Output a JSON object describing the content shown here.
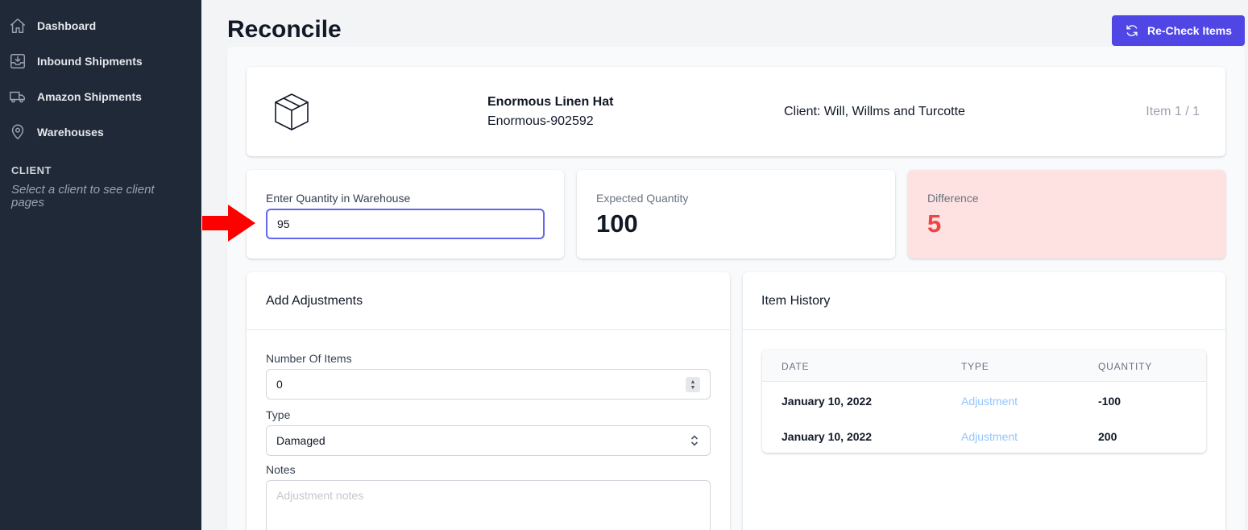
{
  "sidebar": {
    "items": [
      {
        "label": "Dashboard",
        "icon": "home-icon"
      },
      {
        "label": "Inbound Shipments",
        "icon": "inbox-download-icon"
      },
      {
        "label": "Amazon Shipments",
        "icon": "truck-icon"
      },
      {
        "label": "Warehouses",
        "icon": "map-pin-icon"
      }
    ],
    "client_heading": "CLIENT",
    "client_note": "Select a client to see client pages"
  },
  "header": {
    "title": "Reconcile",
    "recheck_label": "Re-Check Items"
  },
  "item": {
    "name": "Enormous Linen Hat",
    "sku": "Enormous-902592",
    "client": "Client: Will, Willms and Turcotte",
    "counter": "Item 1 / 1"
  },
  "stats": {
    "enter_qty_label": "Enter Quantity in Warehouse",
    "enter_qty_value": "95",
    "expected_label": "Expected Quantity",
    "expected_value": "100",
    "difference_label": "Difference",
    "difference_value": "5"
  },
  "adjustments": {
    "title": "Add Adjustments",
    "number_label": "Number Of Items",
    "number_value": "0",
    "type_label": "Type",
    "type_value": "Damaged",
    "notes_label": "Notes",
    "notes_placeholder": "Adjustment notes"
  },
  "history": {
    "title": "Item History",
    "columns": [
      "DATE",
      "TYPE",
      "QUANTITY"
    ],
    "rows": [
      {
        "date": "January 10, 2022",
        "type": "Adjustment",
        "quantity": "-100"
      },
      {
        "date": "January 10, 2022",
        "type": "Adjustment",
        "quantity": "200"
      }
    ]
  },
  "colors": {
    "sidebar_bg": "#1f2937",
    "accent": "#4f46e5",
    "difference_bg": "#fee2e2",
    "difference_text": "#ef4444",
    "annotation_arrow": "#ff0000"
  }
}
